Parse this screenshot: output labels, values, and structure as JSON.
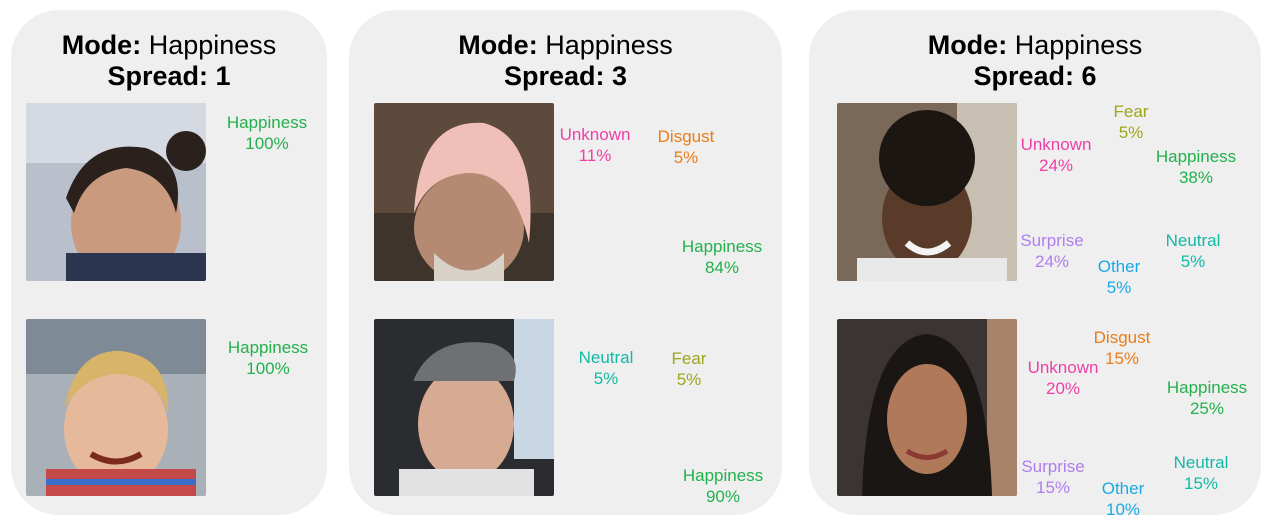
{
  "colors": {
    "Happiness": "#22b14c",
    "Unknown": "#ee3fa8",
    "Disgust": "#ea7d17",
    "Fear": "#9ea61a",
    "Neutral": "#12b9a5",
    "Other": "#1aa9e8",
    "Surprise": "#b07df0"
  },
  "panels": [
    {
      "mode_label": "Mode:",
      "mode_value": "Happiness",
      "spread_label": "Spread: 1",
      "rows": [
        {
          "photo": "woman-smiling-hair-bun-photo",
          "slices": [
            {
              "label": "Happiness",
              "pct": "100%",
              "value": 100
            }
          ]
        },
        {
          "photo": "boy-smiling-blond-photo",
          "slices": [
            {
              "label": "Happiness",
              "pct": "100%",
              "value": 100
            }
          ]
        }
      ]
    },
    {
      "mode_label": "Mode:",
      "mode_value": "Happiness",
      "spread_label": "Spread: 3",
      "rows": [
        {
          "photo": "man-pink-head-wrap-photo",
          "slices": [
            {
              "label": "Happiness",
              "pct": "84%",
              "value": 84
            },
            {
              "label": "Unknown",
              "pct": "11%",
              "value": 11
            },
            {
              "label": "Disgust",
              "pct": "5%",
              "value": 5
            }
          ]
        },
        {
          "photo": "man-in-car-cap-photo",
          "slices": [
            {
              "label": "Happiness",
              "pct": "90%",
              "value": 90
            },
            {
              "label": "Neutral",
              "pct": "5%",
              "value": 5
            },
            {
              "label": "Fear",
              "pct": "5%",
              "value": 5
            }
          ]
        }
      ]
    },
    {
      "mode_label": "Mode:",
      "mode_value": "Happiness",
      "spread_label": "Spread: 6",
      "rows": [
        {
          "photo": "teen-curly-hair-earphones-photo",
          "slices": [
            {
              "label": "Happiness",
              "pct": "38%",
              "value": 38
            },
            {
              "label": "Neutral",
              "pct": "5%",
              "value": 5
            },
            {
              "label": "Other",
              "pct": "5%",
              "value": 5
            },
            {
              "label": "Surprise",
              "pct": "24%",
              "value": 24
            },
            {
              "label": "Unknown",
              "pct": "24%",
              "value": 24
            },
            {
              "label": "Fear",
              "pct": "5%",
              "value": 5
            }
          ]
        },
        {
          "photo": "woman-long-dark-hair-photo",
          "slices": [
            {
              "label": "Disgust",
              "pct": "15%",
              "value": 15
            },
            {
              "label": "Happiness",
              "pct": "25%",
              "value": 25
            },
            {
              "label": "Neutral",
              "pct": "15%",
              "value": 15
            },
            {
              "label": "Other",
              "pct": "10%",
              "value": 10
            },
            {
              "label": "Surprise",
              "pct": "15%",
              "value": 15
            },
            {
              "label": "Unknown",
              "pct": "20%",
              "value": 20
            }
          ]
        }
      ]
    }
  ],
  "chart_data": [
    {
      "type": "pie",
      "title": "Mode: Happiness Spread: 1",
      "series": [
        {
          "labels": [
            "Happiness"
          ],
          "values": [
            100
          ]
        },
        {
          "labels": [
            "Happiness"
          ],
          "values": [
            100
          ]
        }
      ]
    },
    {
      "type": "pie",
      "title": "Mode: Happiness Spread: 3",
      "series": [
        {
          "labels": [
            "Happiness",
            "Unknown",
            "Disgust"
          ],
          "values": [
            84,
            11,
            5
          ]
        },
        {
          "labels": [
            "Happiness",
            "Neutral",
            "Fear"
          ],
          "values": [
            90,
            5,
            5
          ]
        }
      ]
    },
    {
      "type": "pie",
      "title": "Mode: Happiness Spread: 6",
      "series": [
        {
          "labels": [
            "Happiness",
            "Neutral",
            "Other",
            "Surprise",
            "Unknown",
            "Fear"
          ],
          "values": [
            38,
            5,
            5,
            24,
            24,
            5
          ]
        },
        {
          "labels": [
            "Disgust",
            "Happiness",
            "Neutral",
            "Other",
            "Surprise",
            "Unknown"
          ],
          "values": [
            15,
            25,
            15,
            10,
            15,
            20
          ]
        }
      ]
    }
  ]
}
